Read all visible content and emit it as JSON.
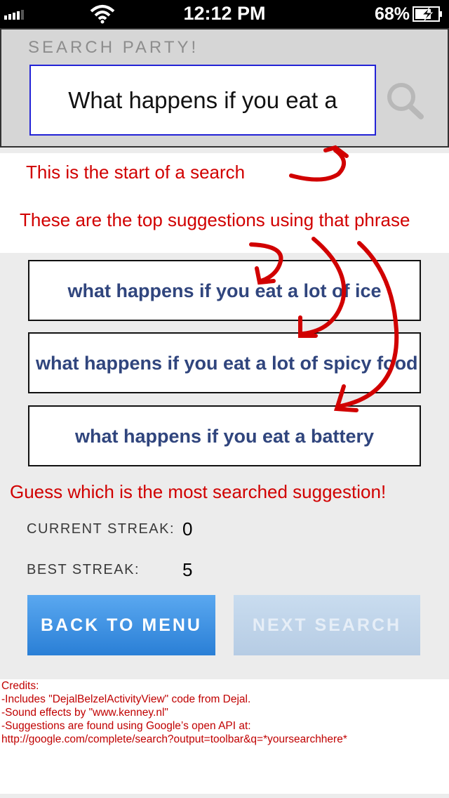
{
  "status_bar": {
    "time": "12:12 PM",
    "battery_percent": "68%",
    "icons": [
      "signal-icon",
      "wifi-icon",
      "battery-charging-icon"
    ]
  },
  "header": {
    "title": "SEARCH PARTY!",
    "search_text": "What happens if you eat a",
    "search_icon": "search-icon"
  },
  "annotations": {
    "start_note": "This is the start of a search",
    "suggestions_note": "These are the top suggestions using that phrase",
    "guess_note": "Guess which is the most searched suggestion!"
  },
  "suggestions": [
    "what happens if you eat a lot of ice",
    "what happens if you eat a lot of spicy food",
    "what happens if you eat a battery"
  ],
  "stats": {
    "current_label": "CURRENT STREAK:",
    "current_value": "0",
    "best_label": "BEST STREAK:",
    "best_value": "5"
  },
  "buttons": {
    "back": "BACK TO MENU",
    "next": "NEXT SEARCH"
  },
  "credits": [
    "Credits:",
    "-Includes \"DejalBelzelActivityView\" code from Dejal.",
    "-Sound effects by \"www.kenney.nl\"",
    "-Suggestions are found using Google’s open API at:",
    "http://google.com/complete/search?output=toolbar&q=*yoursearchhere*"
  ],
  "colors": {
    "annotation_red": "#d10000",
    "suggestion_blue": "#30457d",
    "button_blue": "#2a7fd6",
    "search_border": "#2323d6"
  }
}
